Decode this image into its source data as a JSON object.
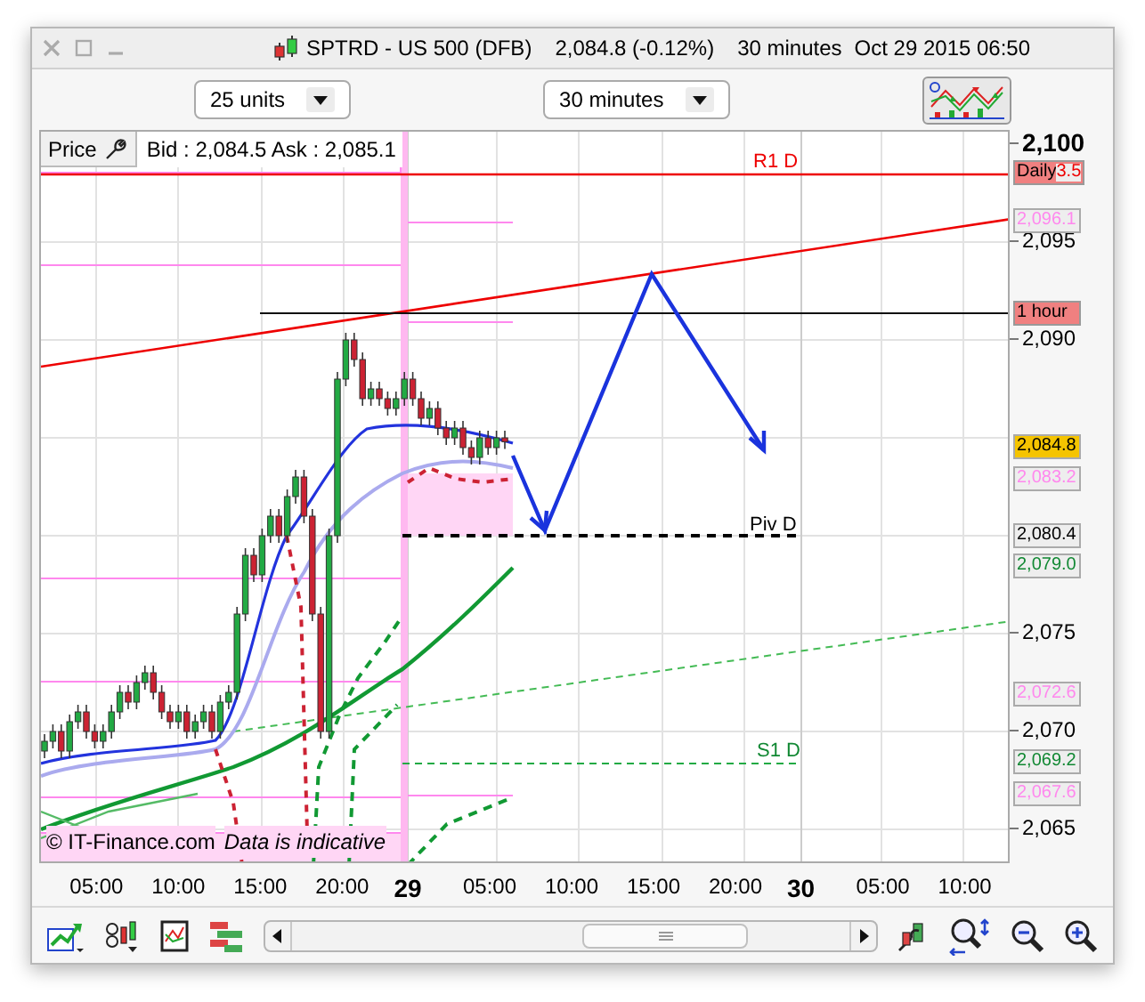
{
  "window": {
    "title": "SPTRD - US 500 (DFB)",
    "price": "2,084.8 (-0.12%)",
    "interval": "30 minutes",
    "datetime": "Oct 29 2015 06:50"
  },
  "controls": {
    "units_select": "25 units",
    "interval_select": "30 minutes"
  },
  "chart": {
    "price_button": "Price",
    "quote": "Bid : 2,084.5 Ask : 2,085.1",
    "copyright": "© IT-Finance.com",
    "disclaimer": "Data is indicative",
    "line_labels": [
      {
        "text": "R1 D",
        "kind": "resistance"
      },
      {
        "text": "Piv D",
        "kind": "pivot"
      },
      {
        "text": "S1 D",
        "kind": "support"
      }
    ]
  },
  "price_axis": {
    "ticks": [
      {
        "label": "2,100",
        "bold": true
      },
      {
        "label": "2,095",
        "bold": false
      },
      {
        "label": "2,090",
        "bold": false
      },
      {
        "label": "2,075",
        "bold": false
      },
      {
        "label": "2,070",
        "bold": false
      },
      {
        "label": "2,065",
        "bold": false
      }
    ],
    "tags": [
      {
        "text": "Daily",
        "trailing": "3.5",
        "kind": "daily"
      },
      {
        "text": "2,096.1",
        "kind": "pink"
      },
      {
        "text": "1 hour",
        "kind": "hour"
      },
      {
        "text": "2,084.8",
        "kind": "current"
      },
      {
        "text": "2,083.2",
        "kind": "pink"
      },
      {
        "text": "2,080.4",
        "kind": "black"
      },
      {
        "text": "2,079.0",
        "kind": "green"
      },
      {
        "text": "2,072.6",
        "kind": "pink"
      },
      {
        "text": "2,069.2",
        "kind": "green"
      },
      {
        "text": "2,067.6",
        "kind": "pink"
      }
    ]
  },
  "time_axis": [
    {
      "label": "05:00",
      "bold": false
    },
    {
      "label": "10:00",
      "bold": false
    },
    {
      "label": "15:00",
      "bold": false
    },
    {
      "label": "20:00",
      "bold": false
    },
    {
      "label": "29",
      "bold": true
    },
    {
      "label": "05:00",
      "bold": false
    },
    {
      "label": "10:00",
      "bold": false
    },
    {
      "label": "15:00",
      "bold": false
    },
    {
      "label": "20:00",
      "bold": false
    },
    {
      "label": "30",
      "bold": true
    },
    {
      "label": "05:00",
      "bold": false
    },
    {
      "label": "10:00",
      "bold": false
    }
  ]
}
